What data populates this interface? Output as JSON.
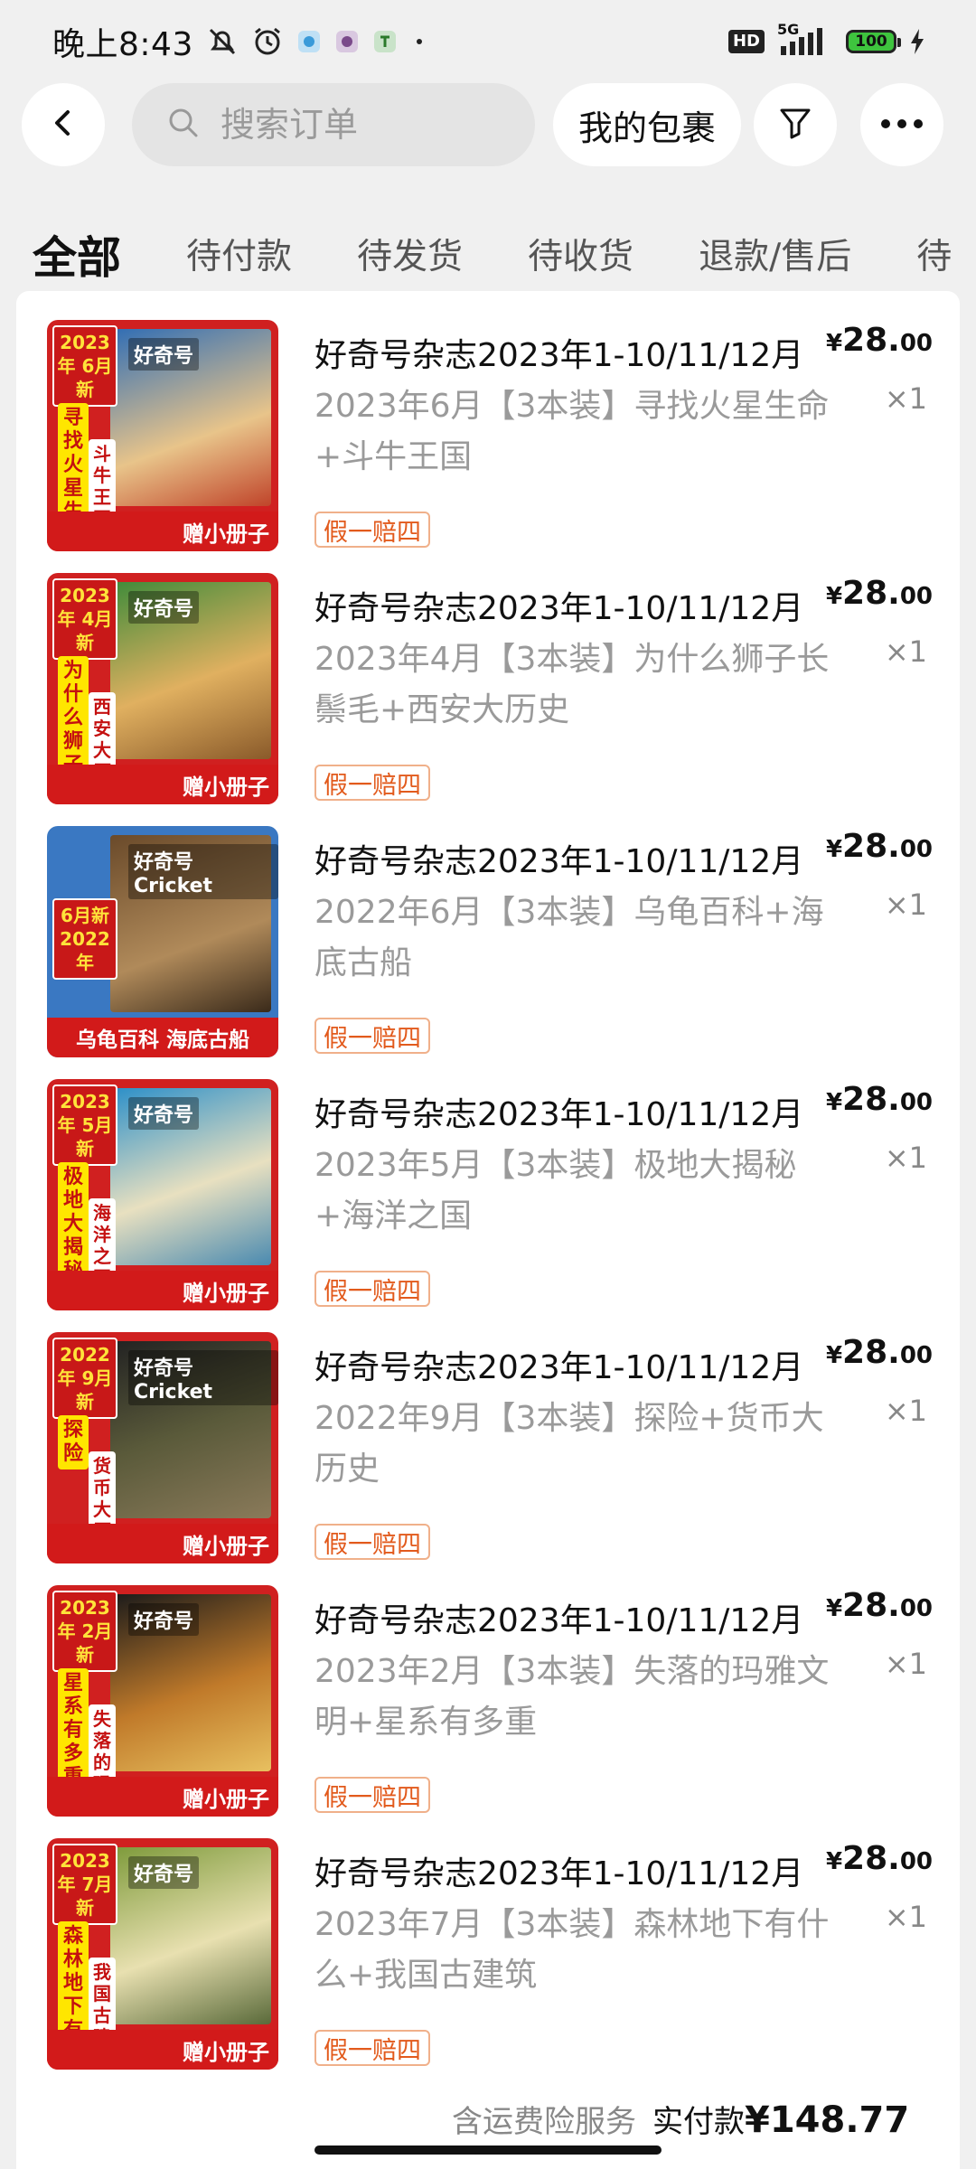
{
  "status_bar": {
    "time": "晚上8:43",
    "hd": "HD",
    "network": "5G",
    "battery": "100"
  },
  "top_bar": {
    "search_placeholder": "搜索订单",
    "package_button": "我的包裹"
  },
  "tabs": [
    {
      "label": "全部",
      "active": true
    },
    {
      "label": "待付款"
    },
    {
      "label": "待发货"
    },
    {
      "label": "待收货"
    },
    {
      "label": "退款/售后"
    },
    {
      "label": "待"
    }
  ],
  "items": [
    {
      "title": "好奇号杂志2023年1-10/11/12月",
      "spec": "2023年6月【3本装】寻找火星生命+斗牛王国",
      "tag": "假一赔四",
      "price_yen": "¥",
      "price_int": "28.",
      "price_dec": "00",
      "qty": "×1",
      "thumb": {
        "badge": "2023年 6月新",
        "side": "寻找火星生命",
        "side2": "斗牛王国",
        "ribbon": "赠小册子",
        "cover": "好奇号",
        "color": "#2f6db5"
      }
    },
    {
      "title": "好奇号杂志2023年1-10/11/12月",
      "spec": "2023年4月【3本装】为什么狮子长鬃毛+西安大历史",
      "tag": "假一赔四",
      "price_yen": "¥",
      "price_int": "28.",
      "price_dec": "00",
      "qty": "×1",
      "thumb": {
        "badge": "2023年 4月新",
        "side": "为什么狮子长鬃毛",
        "side2": "西安大历史",
        "ribbon": "赠小册子",
        "cover": "好奇号",
        "color": "#3f8b3a"
      }
    },
    {
      "title": "好奇号杂志2023年1-10/11/12月",
      "spec": "2022年6月【3本装】乌龟百科+海底古船",
      "tag": "假一赔四",
      "price_yen": "¥",
      "price_int": "28.",
      "price_dec": "00",
      "qty": "×1",
      "thumb": {
        "badge": "6月新 2022年",
        "side": "",
        "side2": "",
        "ribbon": "乌龟百科 海底古船",
        "cover": "好奇号 Cricket",
        "color": "#3a78c2"
      }
    },
    {
      "title": "好奇号杂志2023年1-10/11/12月",
      "spec": "2023年5月【3本装】极地大揭秘+海洋之国",
      "tag": "假一赔四",
      "price_yen": "¥",
      "price_int": "28.",
      "price_dec": "00",
      "qty": "×1",
      "thumb": {
        "badge": "2023年 5月新",
        "side": "极地大揭秘",
        "side2": "海洋之国",
        "ribbon": "赠小册子",
        "cover": "好奇号",
        "color": "#2b8fc9"
      }
    },
    {
      "title": "好奇号杂志2023年1-10/11/12月",
      "spec": "2022年9月【3本装】探险+货币大历史",
      "tag": "假一赔四",
      "price_yen": "¥",
      "price_int": "28.",
      "price_dec": "00",
      "qty": "×1",
      "thumb": {
        "badge": "2022年 9月新",
        "side": "探险",
        "side2": "货币大历史",
        "ribbon": "赠小册子",
        "cover": "好奇号 Cricket",
        "color": "#5a5a3a"
      }
    },
    {
      "title": "好奇号杂志2023年1-10/11/12月",
      "spec": "2023年2月【3本装】失落的玛雅文明+星系有多重",
      "tag": "假一赔四",
      "price_yen": "¥",
      "price_int": "28.",
      "price_dec": "00",
      "qty": "×1",
      "thumb": {
        "badge": "2023年 2月新",
        "side": "星系有多重",
        "side2": "失落的玛雅文明",
        "ribbon": "赠小册子",
        "cover": "好奇号",
        "color": "#c07a2a"
      }
    },
    {
      "title": "好奇号杂志2023年1-10/11/12月",
      "spec": "2023年7月【3本装】森林地下有什么+我国古建筑",
      "tag": "假一赔四",
      "price_yen": "¥",
      "price_int": "28.",
      "price_dec": "00",
      "qty": "×1",
      "thumb": {
        "badge": "2023年 7月新",
        "side": "森林地下有什么",
        "side2": "我国古建筑",
        "ribbon": "赠小册子",
        "cover": "好奇号",
        "color": "#7d9a3a"
      }
    }
  ],
  "footer": {
    "text": "含运费险服务",
    "paid_label": "实付款",
    "paid_amount": "¥148.77"
  },
  "colors": {
    "background": "#f0f0f0",
    "tag_text": "#e25a1c",
    "tag_border": "#f0b08a",
    "secondary_text": "#9a9a9a"
  }
}
